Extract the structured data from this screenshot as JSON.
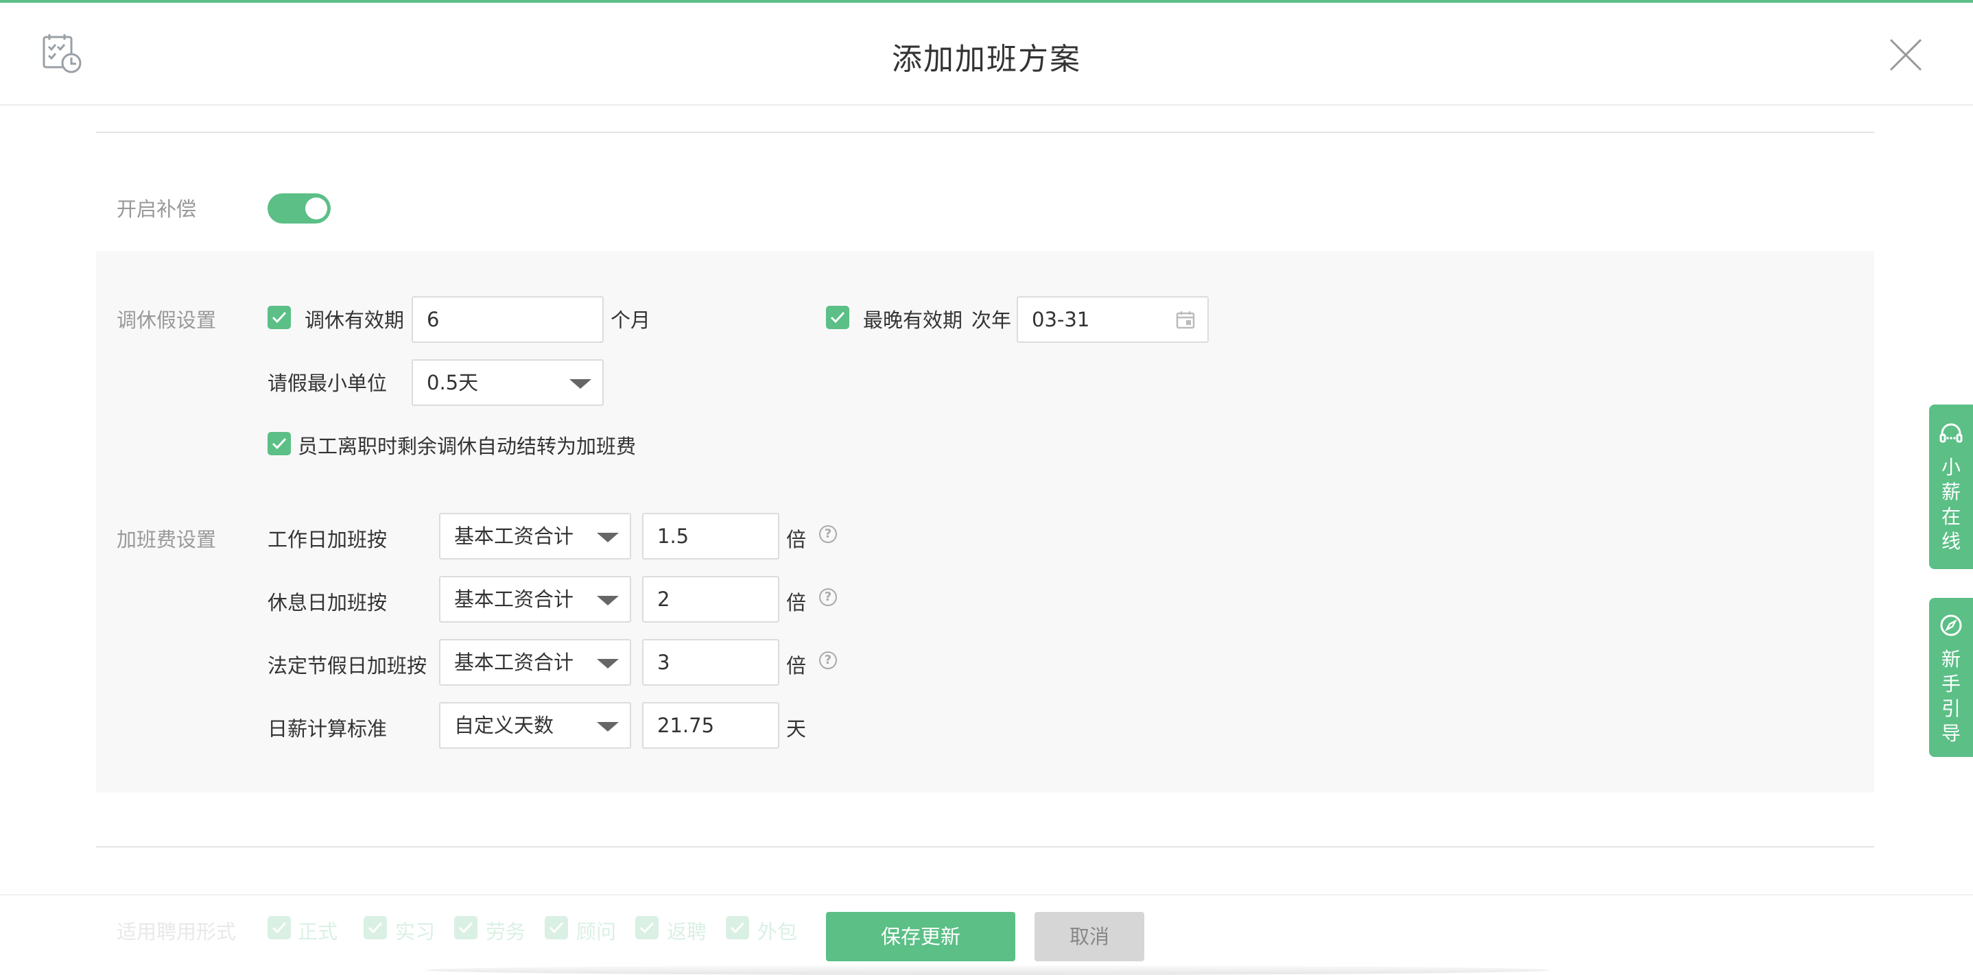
{
  "header": {
    "title": "添加加班方案",
    "app_icon": "calendar-clock-icon",
    "close_icon": "close-icon"
  },
  "compensation": {
    "label": "开启补偿",
    "enabled": true
  },
  "leave_settings": {
    "section_label": "调休假设置",
    "validity": {
      "label": "调休有效期",
      "checked": true,
      "value": "6",
      "unit": "个月"
    },
    "latest": {
      "label": "最晚有效期",
      "checked": true,
      "prefix": "次年",
      "value": "03-31"
    },
    "min_unit": {
      "label": "请假最小单位",
      "value": "0.5天"
    },
    "auto_convert": {
      "label": "员工离职时剩余调休自动结转为加班费",
      "checked": true
    }
  },
  "overtime_pay": {
    "section_label": "加班费设置",
    "rows": [
      {
        "label": "工作日加班按",
        "basis": "基本工资合计",
        "value": "1.5",
        "unit": "倍",
        "help": "?"
      },
      {
        "label": "休息日加班按",
        "basis": "基本工资合计",
        "value": "2",
        "unit": "倍",
        "help": "?"
      },
      {
        "label": "法定节假日加班按",
        "basis": "基本工资合计",
        "value": "3",
        "unit": "倍",
        "help": "?"
      }
    ],
    "daily_wage": {
      "label": "日薪计算标准",
      "basis": "自定义天数",
      "value": "21.75",
      "unit": "天"
    }
  },
  "employment_types": {
    "label": "适用聘用形式",
    "options": [
      "正式",
      "实习",
      "劳务",
      "顾问",
      "返聘",
      "外包"
    ]
  },
  "footer": {
    "save_label": "保存更新",
    "cancel_label": "取消"
  },
  "side_tabs": [
    {
      "label": "小薪在线",
      "icon": "headset-icon"
    },
    {
      "label": "新手引导",
      "icon": "compass-icon"
    }
  ],
  "colors": {
    "accent": "#5bbf86",
    "panel_bg": "#f8f8f8"
  }
}
